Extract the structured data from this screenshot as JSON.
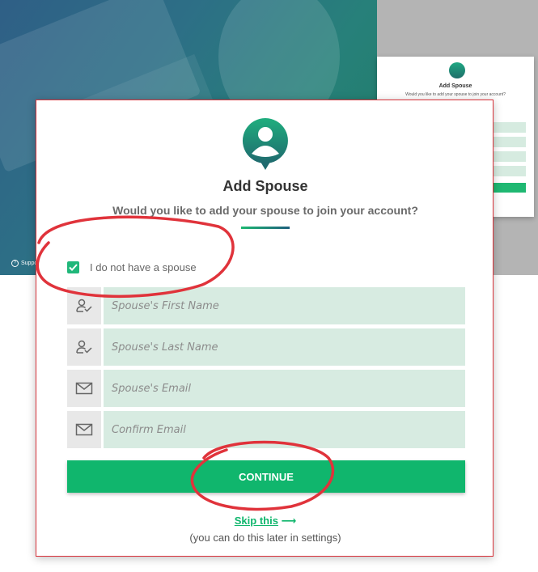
{
  "background": {
    "support_text": "Suppo",
    "mini_card": {
      "title": "Add Spouse",
      "subtitle": "Would you like to add your spouse to join your account?"
    }
  },
  "modal": {
    "title": "Add Spouse",
    "subtitle": "Would you like to add your spouse to join your account?",
    "no_spouse_checkbox": {
      "label": "I do not have a spouse",
      "checked": true
    },
    "fields": {
      "first_name": {
        "placeholder": "Spouse's First Name",
        "value": "",
        "icon": "user-check-icon"
      },
      "last_name": {
        "placeholder": "Spouse's Last Name",
        "value": "",
        "icon": "user-check-icon"
      },
      "email": {
        "placeholder": "Spouse's Email",
        "value": "",
        "icon": "envelope-icon"
      },
      "confirm_email": {
        "placeholder": "Confirm Email",
        "value": "",
        "icon": "envelope-icon"
      }
    },
    "continue_label": "CONTINUE",
    "skip_label": "Skip this",
    "skip_arrow": "⟶",
    "skip_note": "(you can do this later in settings)"
  },
  "colors": {
    "accent_green": "#10b66d",
    "field_bg": "#d7ebe1",
    "annotation_red": "#e0333b",
    "modal_border": "#d8323a"
  }
}
